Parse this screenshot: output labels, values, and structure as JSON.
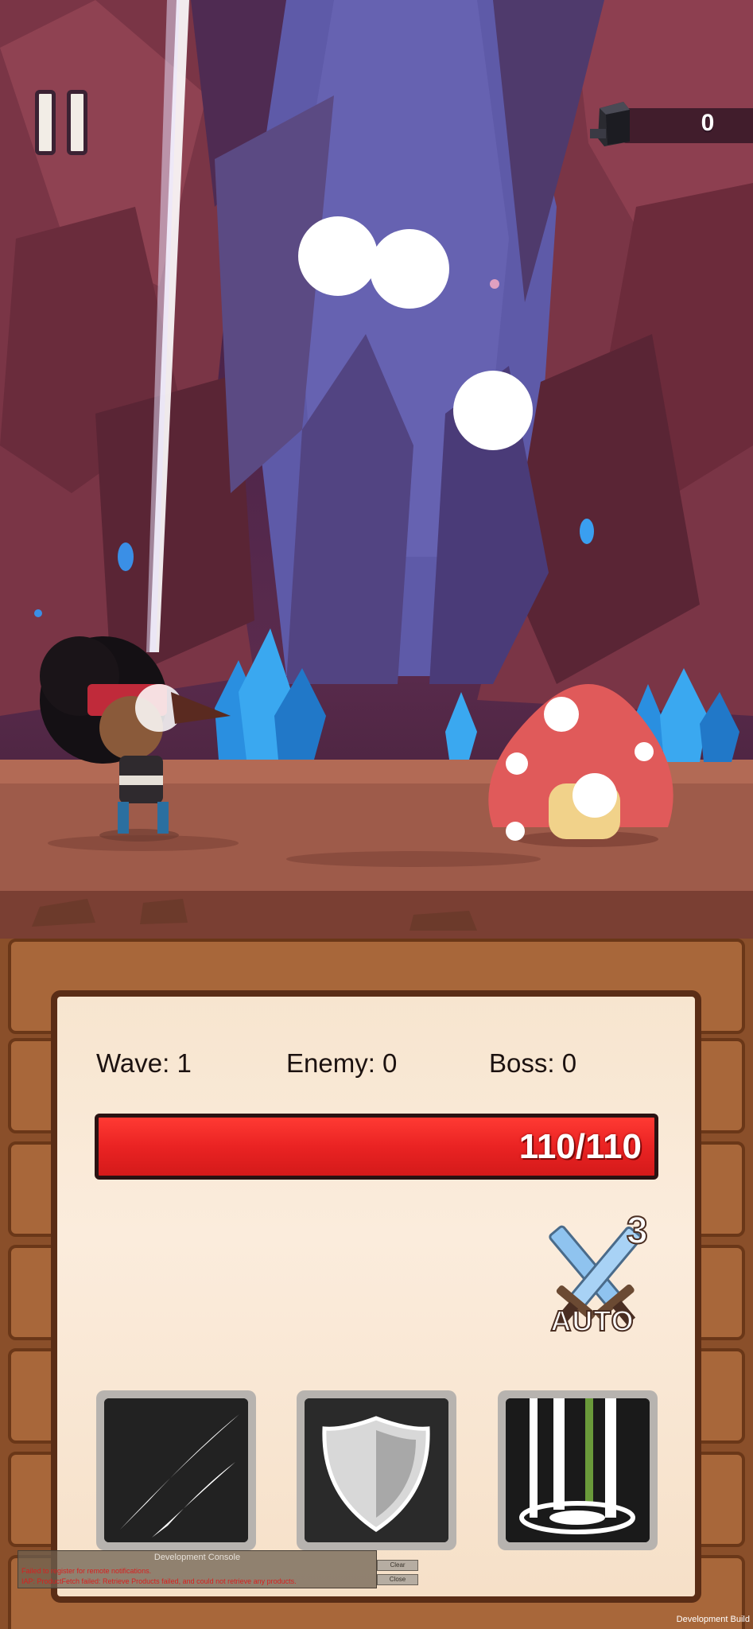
{
  "hud": {
    "currency_value": "0",
    "currency_icon": "anvil-icon",
    "pause_icon": "pause-icon"
  },
  "stats": {
    "wave": "Wave: 1",
    "enemy": "Enemy: 0",
    "boss": "Boss: 0"
  },
  "health": {
    "text": "110/110",
    "current": 110,
    "max": 110
  },
  "auto_attack": {
    "label": "AUTO",
    "count": "3",
    "icon": "crossed-swords-icon"
  },
  "skills": [
    {
      "icon": "slash-claw-icon"
    },
    {
      "icon": "shield-icon"
    },
    {
      "icon": "ground-slam-icon"
    }
  ],
  "dev_console": {
    "title": "Development Console",
    "line1": "Failed to register for remote notifications.",
    "line2": "IAP: ProductFetch failed: Retrieve Products failed, and could not retrieve any products.",
    "clear_label": "Clear",
    "close_label": "Close"
  },
  "build_label": "Development Build",
  "colors": {
    "hp_fill": "#e92222",
    "wood": "#8a4f2a",
    "paper": "#f8e6d1",
    "cave": "#4b2349"
  }
}
